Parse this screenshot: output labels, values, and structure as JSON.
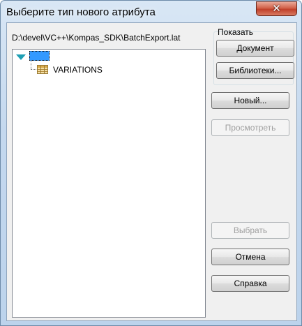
{
  "window": {
    "title": "Выберите тип нового атрибута",
    "close_glyph": "✕"
  },
  "path": "D:\\devel\\VC++\\Kompas_SDK\\BatchExport.lat",
  "tree": {
    "root_label": "",
    "children": [
      {
        "label": "VARIATIONS",
        "icon": "table-icon"
      }
    ]
  },
  "show_group": {
    "label": "Показать",
    "document_button": "Документ",
    "libraries_button": "Библиотеки..."
  },
  "buttons": {
    "new": "Новый...",
    "view": "Просмотреть",
    "select": "Выбрать",
    "cancel": "Отмена",
    "help": "Справка"
  },
  "colors": {
    "selection": "#3399ff",
    "expander": "#1e9fb4",
    "close_button": "#c0402a",
    "disabled_text": "#a0a0a0"
  }
}
